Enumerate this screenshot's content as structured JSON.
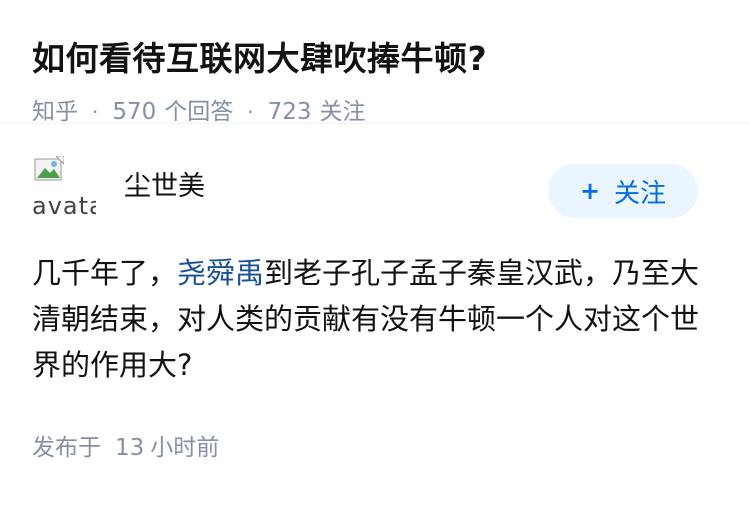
{
  "question": {
    "title": "如何看待互联网大肆吹捧牛顿?",
    "source": "知乎",
    "answer_count": "570",
    "answer_label": "个回答",
    "follow_count": "723",
    "follow_label": "关注"
  },
  "answer": {
    "author": {
      "name": "尘世美",
      "avatar_alt": "avatar"
    },
    "follow_button": {
      "label": "关注",
      "icon": "plus-icon"
    },
    "content": {
      "part1": "几千年了，",
      "link_text": "尧舜禹",
      "part2": "到老子孔子孟子秦皇汉武，乃至大清朝结束，对人类的贡献有没有牛顿一个人对这个世界的作用大?"
    },
    "published": {
      "prefix": "发布于",
      "value": "13",
      "unit": "小时前"
    }
  },
  "colors": {
    "accent": "#056de8",
    "link": "#175199",
    "muted": "#8590a6"
  }
}
